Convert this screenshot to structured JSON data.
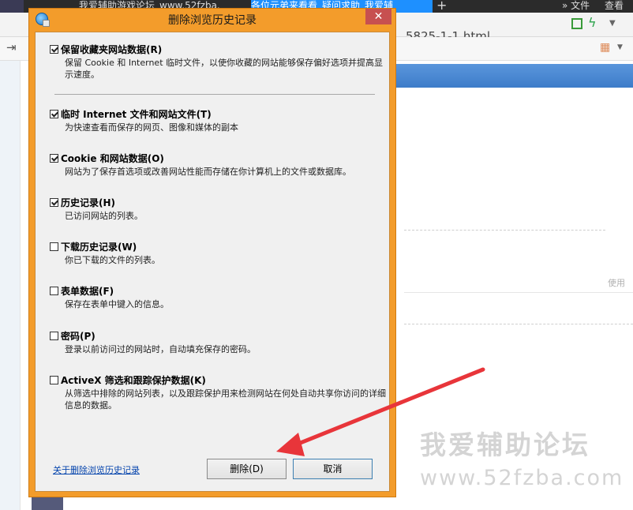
{
  "browser": {
    "tabs": [
      {
        "label": "我爱辅助游戏论坛_www.52fzba.",
        "active": false
      },
      {
        "label": "各位元弟来看看_疑问求助_我爱辅",
        "active": true
      }
    ],
    "top_right": [
      "文件",
      "查看"
    ],
    "url_fragment": "5825-1-1.html",
    "bg_text_right": "使用",
    "watermark_cn": "我爱辅助论坛",
    "watermark_url": "www.52fzba.com"
  },
  "dialog": {
    "title": "删除浏览历史记录",
    "close_symbol": "✕",
    "options": [
      {
        "label": "保留收藏夹网站数据(R)",
        "desc": "保留 Cookie 和 Internet 临时文件，以使你收藏的网站能够保存偏好选项并提高显示速度。",
        "checked": true
      },
      {
        "label": "临时 Internet 文件和网站文件(T)",
        "desc": "为快速查看而保存的网页、图像和媒体的副本",
        "checked": true
      },
      {
        "label": "Cookie 和网站数据(O)",
        "desc": "网站为了保存首选项或改善网站性能而存储在你计算机上的文件或数据库。",
        "checked": true
      },
      {
        "label": "历史记录(H)",
        "desc": "已访问网站的列表。",
        "checked": true
      },
      {
        "label": "下载历史记录(W)",
        "desc": "你已下载的文件的列表。",
        "checked": false
      },
      {
        "label": "表单数据(F)",
        "desc": "保存在表单中键入的信息。",
        "checked": false
      },
      {
        "label": "密码(P)",
        "desc": "登录以前访问过的网站时，自动填充保存的密码。",
        "checked": false
      },
      {
        "label": "ActiveX 筛选和跟踪保护数据(K)",
        "desc": "从筛选中排除的网站列表，以及跟踪保护用来检测网站在何处自动共享你访问的详细信息的数据。",
        "checked": false
      }
    ],
    "link_label": "关于删除浏览历史记录",
    "delete_label": "删除(D)",
    "cancel_label": "取消"
  },
  "colors": {
    "dialog_frame": "#f39c2b",
    "arrow": "#e8353a",
    "link": "#0645ad"
  }
}
